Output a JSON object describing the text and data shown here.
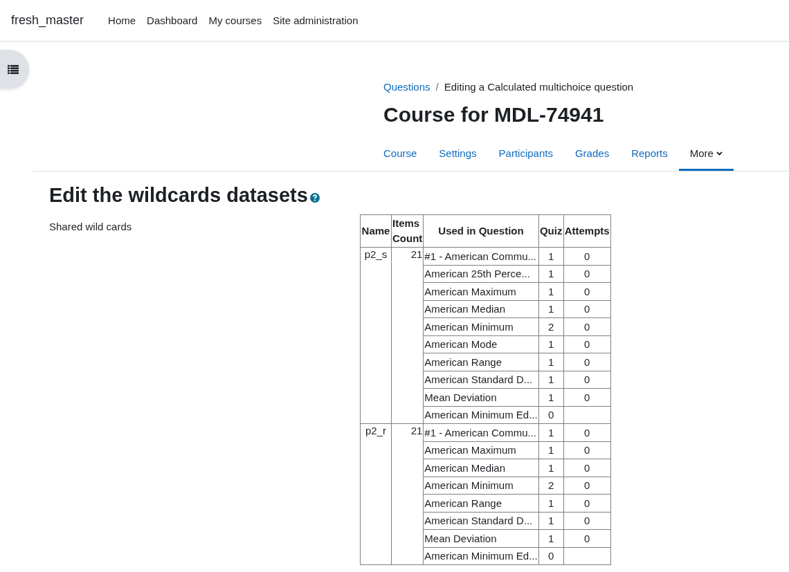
{
  "navbar": {
    "site_name": "fresh_master",
    "links": [
      "Home",
      "Dashboard",
      "My courses",
      "Site administration"
    ]
  },
  "breadcrumb_separator": "/",
  "breadcrumb": [
    {
      "label": "Questions",
      "kind": "link"
    },
    {
      "label": "Editing a Calculated multichoice question",
      "kind": "current"
    }
  ],
  "page_title": "Course for MDL-74941",
  "tabs": [
    {
      "label": "Course",
      "selected": false
    },
    {
      "label": "Settings",
      "selected": false
    },
    {
      "label": "Participants",
      "selected": false
    },
    {
      "label": "Grades",
      "selected": false
    },
    {
      "label": "Reports",
      "selected": false
    },
    {
      "label": "More",
      "selected": true
    }
  ],
  "heading": "Edit the wildcards datasets",
  "form_label": "Shared wild cards",
  "table": {
    "columns": [
      "Name",
      "Items Count",
      "Used in Question",
      "Quiz",
      "Attempts"
    ],
    "datasets": [
      {
        "name": "p2_s",
        "items_count": "21",
        "questions": [
          {
            "question": "#1 - American Commu...",
            "quiz": "1",
            "attempts": "0"
          },
          {
            "question": "American 25th Perce...",
            "quiz": "1",
            "attempts": "0"
          },
          {
            "question": "American Maximum",
            "quiz": "1",
            "attempts": "0"
          },
          {
            "question": "American Median",
            "quiz": "1",
            "attempts": "0"
          },
          {
            "question": "American Minimum",
            "quiz": "2",
            "attempts": "0"
          },
          {
            "question": "American Mode",
            "quiz": "1",
            "attempts": "0"
          },
          {
            "question": "American Range",
            "quiz": "1",
            "attempts": "0"
          },
          {
            "question": "American Standard D...",
            "quiz": "1",
            "attempts": "0"
          },
          {
            "question": "Mean Deviation",
            "quiz": "1",
            "attempts": "0"
          },
          {
            "question": "American Minimum Ed...",
            "quiz": "0"
          }
        ]
      },
      {
        "name": "p2_r",
        "items_count": "21",
        "questions": [
          {
            "question": "#1 - American Commu...",
            "quiz": "1",
            "attempts": "0"
          },
          {
            "question": "American Maximum",
            "quiz": "1",
            "attempts": "0"
          },
          {
            "question": "American Median",
            "quiz": "1",
            "attempts": "0"
          },
          {
            "question": "American Minimum",
            "quiz": "2",
            "attempts": "0"
          },
          {
            "question": "American Range",
            "quiz": "1",
            "attempts": "0"
          },
          {
            "question": "American Standard D...",
            "quiz": "1",
            "attempts": "0"
          },
          {
            "question": "Mean Deviation",
            "quiz": "1",
            "attempts": "0"
          },
          {
            "question": "American Minimum Ed...",
            "quiz": "0"
          }
        ]
      }
    ]
  }
}
